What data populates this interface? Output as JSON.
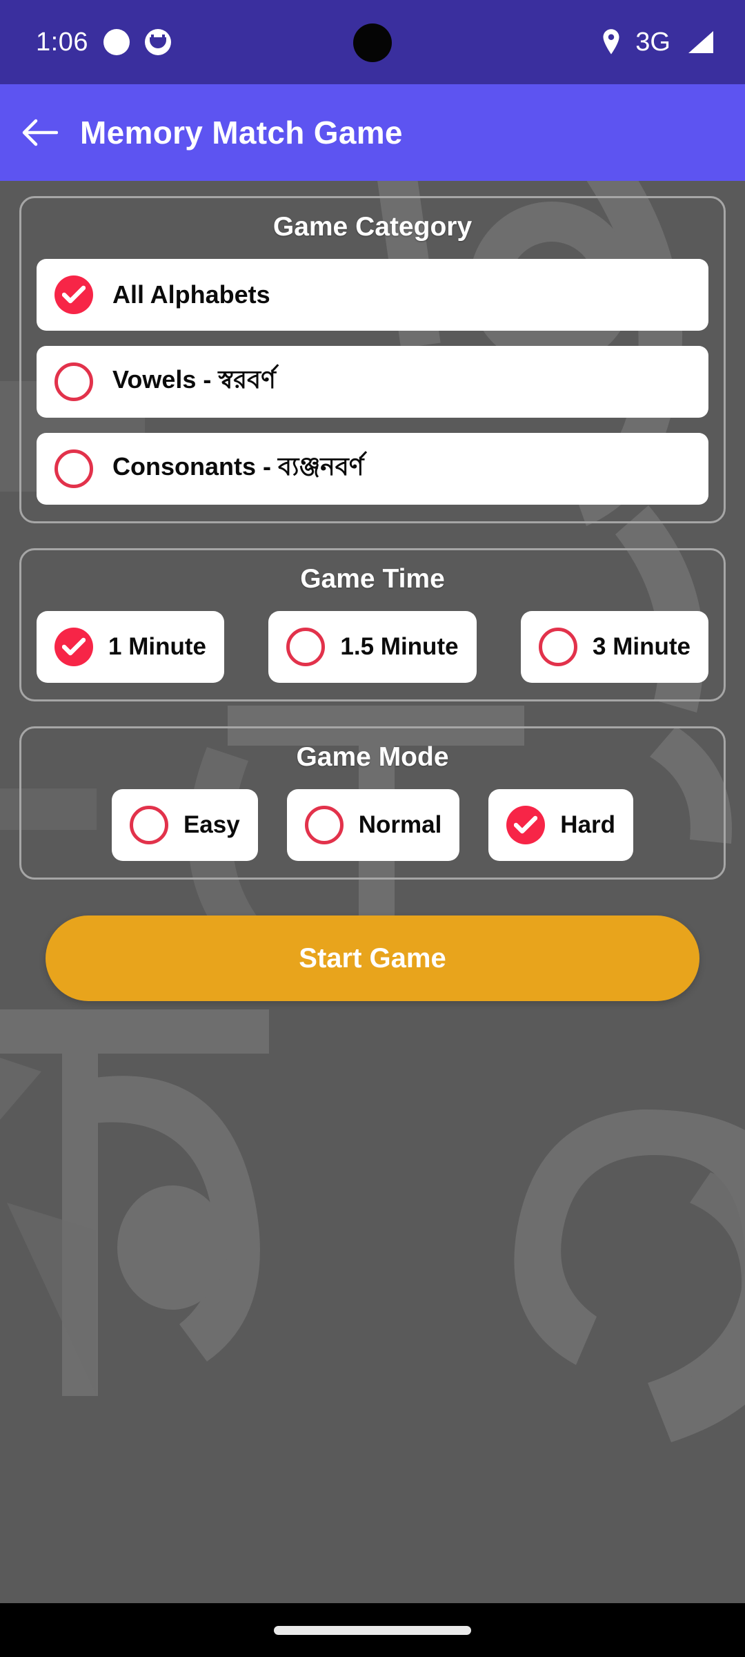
{
  "status_bar": {
    "time": "1:06",
    "network_label": "3G",
    "icons": [
      "notification-dot-icon",
      "cat-notification-icon",
      "location-pin-icon",
      "signal-bars-icon"
    ],
    "background_color": "#3a2f9e"
  },
  "app_bar": {
    "back_label": "back-arrow",
    "title": "Memory Match Game",
    "background_color": "#5d54f1"
  },
  "theme": {
    "page_background": "#5a5a5a",
    "panel_border": "#a6a6a6",
    "accent_red": "#f72547",
    "accent_ring": "#e2324b",
    "start_button": "#e8a41c",
    "card_white": "#ffffff"
  },
  "sections": {
    "category": {
      "title": "Game Category",
      "options": [
        {
          "label": "All Alphabets",
          "selected": true
        },
        {
          "label": "Vowels - স্বরবর্ণ",
          "selected": false
        },
        {
          "label": "Consonants - ব্যঞ্জনবর্ণ",
          "selected": false
        }
      ]
    },
    "time": {
      "title": "Game Time",
      "options": [
        {
          "label": "1 Minute",
          "selected": true
        },
        {
          "label": "1.5 Minute",
          "selected": false
        },
        {
          "label": "3 Minute",
          "selected": false
        }
      ]
    },
    "mode": {
      "title": "Game Mode",
      "options": [
        {
          "label": "Easy",
          "selected": false
        },
        {
          "label": "Normal",
          "selected": false
        },
        {
          "label": "Hard",
          "selected": true
        }
      ]
    }
  },
  "start_button": {
    "label": "Start Game"
  },
  "nav_bar": {
    "handle": "gesture-home-handle"
  }
}
